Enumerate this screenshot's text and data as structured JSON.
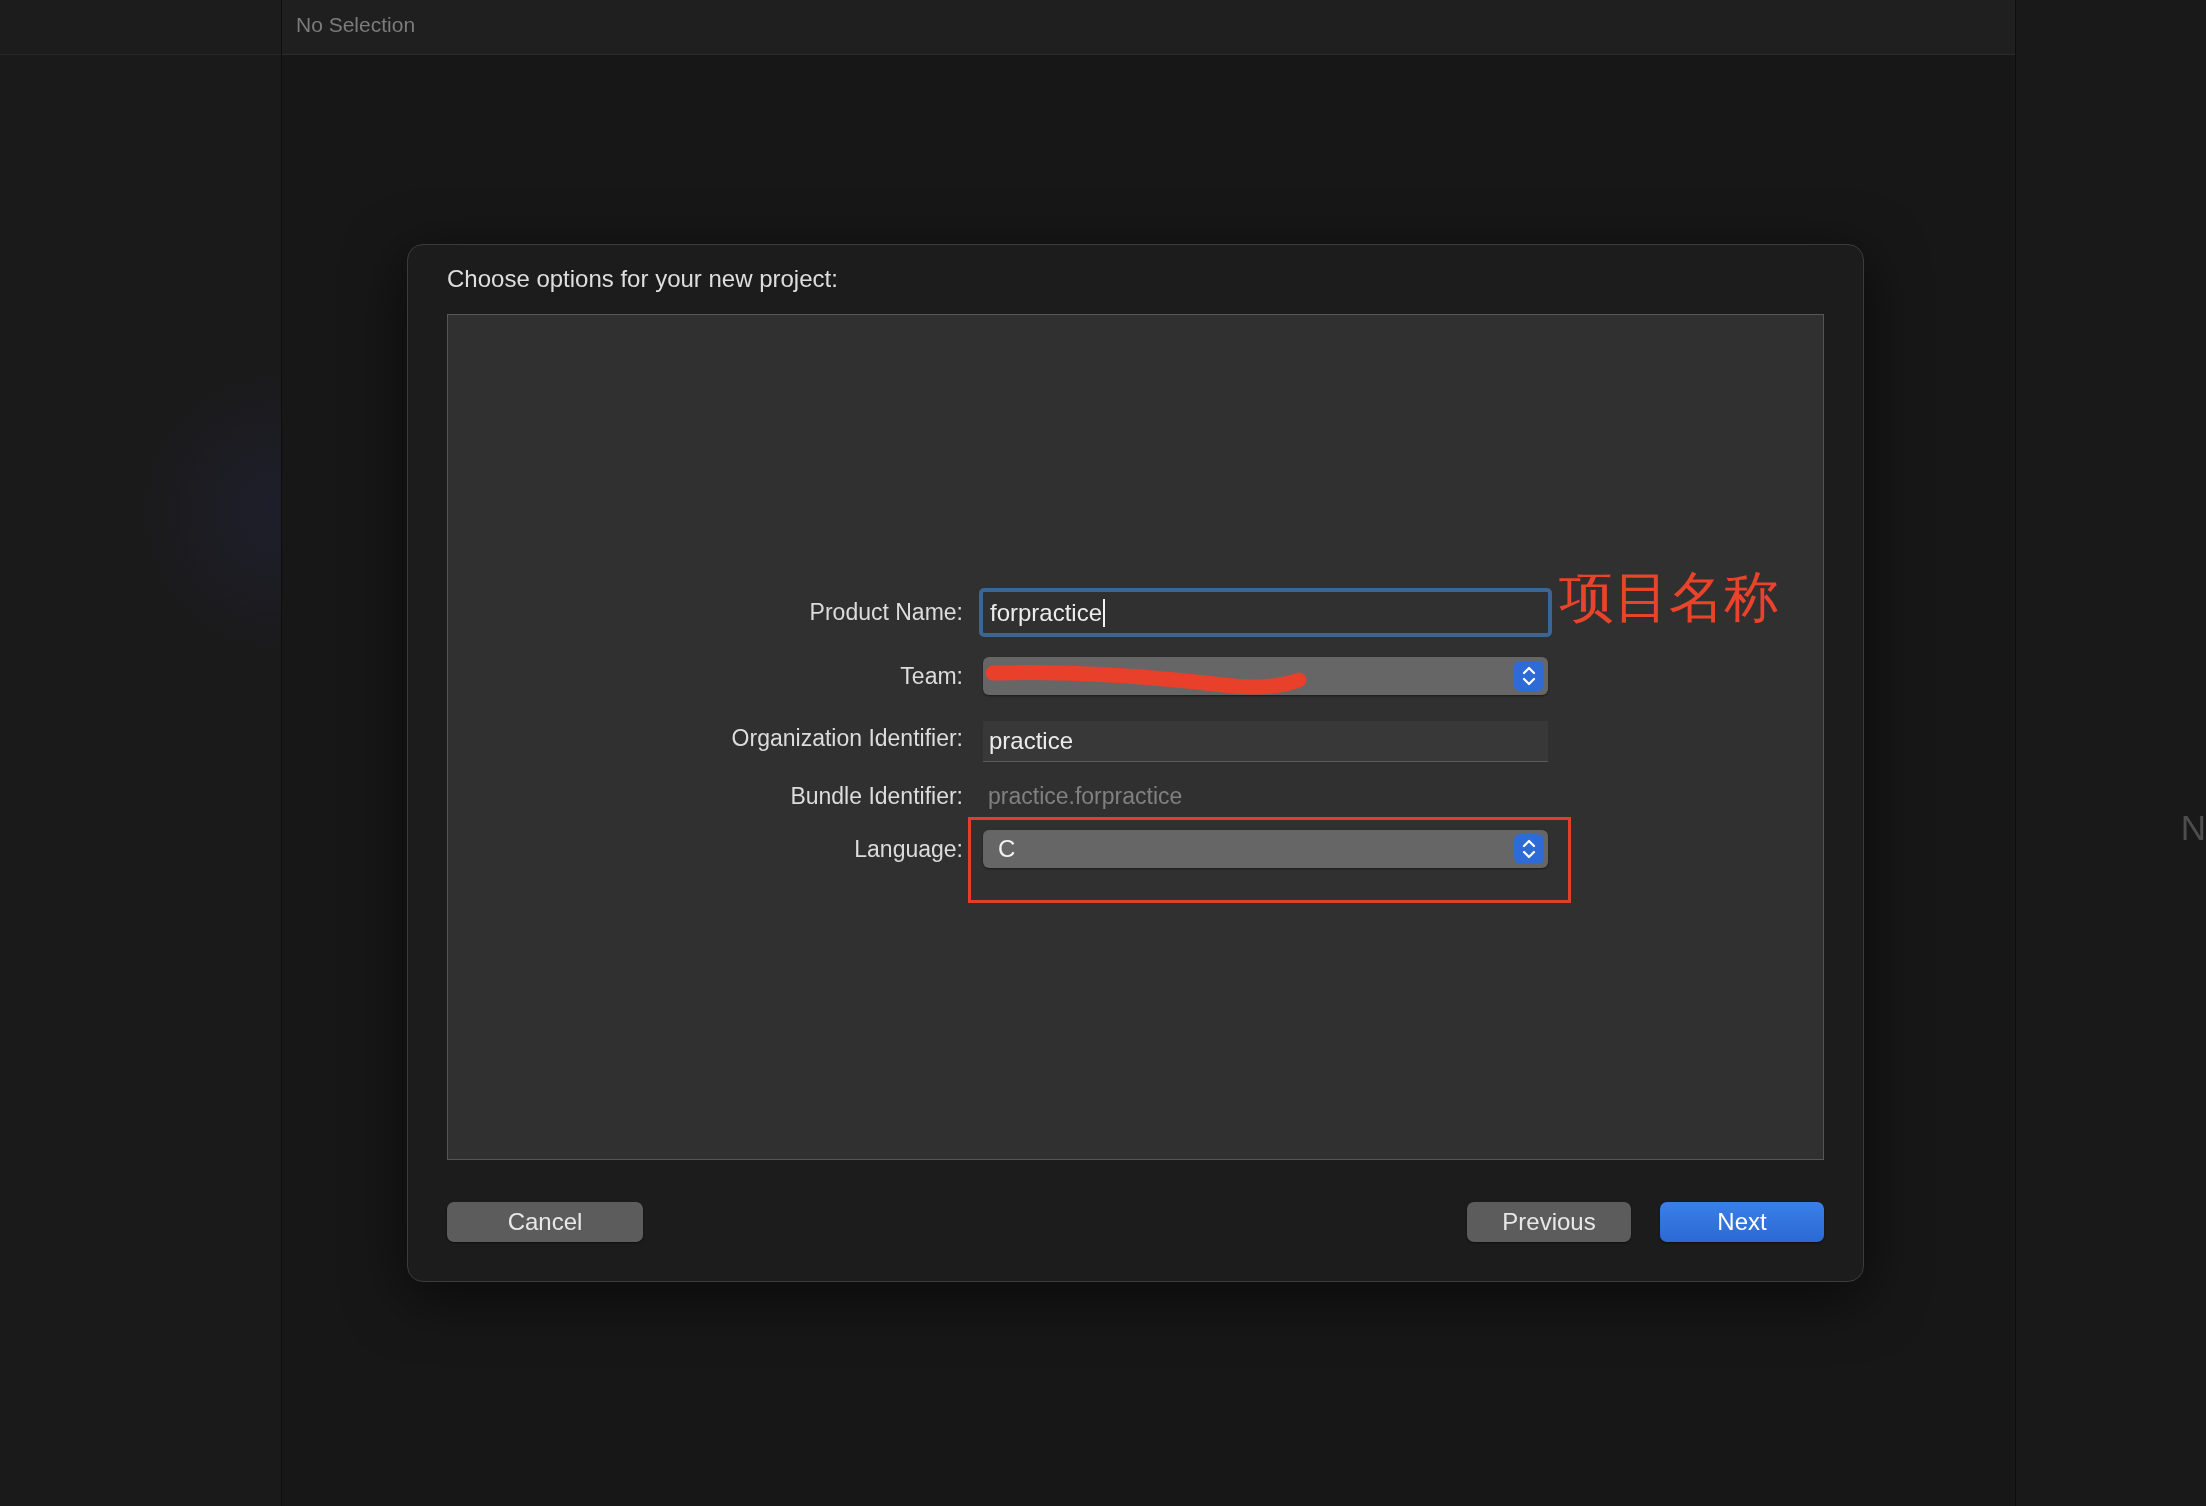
{
  "top_bar": {
    "title": "No Selection"
  },
  "dialog": {
    "title": "Choose options for your new project:",
    "fields": [
      {
        "kind": "text",
        "label": "Product Name:",
        "value": "forpractice",
        "focused": true,
        "annotation": "项目名称"
      },
      {
        "kind": "popup",
        "label": "Team:",
        "redacted": true,
        "highlighted": false
      },
      {
        "kind": "text",
        "label": "Organization Identifier:",
        "value": "practice",
        "focused": false
      },
      {
        "kind": "static",
        "label": "Bundle Identifier:",
        "value": "practice.forpractice"
      },
      {
        "kind": "popup",
        "label": "Language:",
        "value": "C",
        "redacted": false,
        "highlighted": true
      }
    ],
    "buttons": [
      {
        "label": "Cancel",
        "kind": "secondary"
      },
      {
        "label": "Previous",
        "kind": "secondary"
      },
      {
        "label": "Next",
        "kind": "primary"
      }
    ]
  },
  "right_panel": {
    "text": "N"
  }
}
